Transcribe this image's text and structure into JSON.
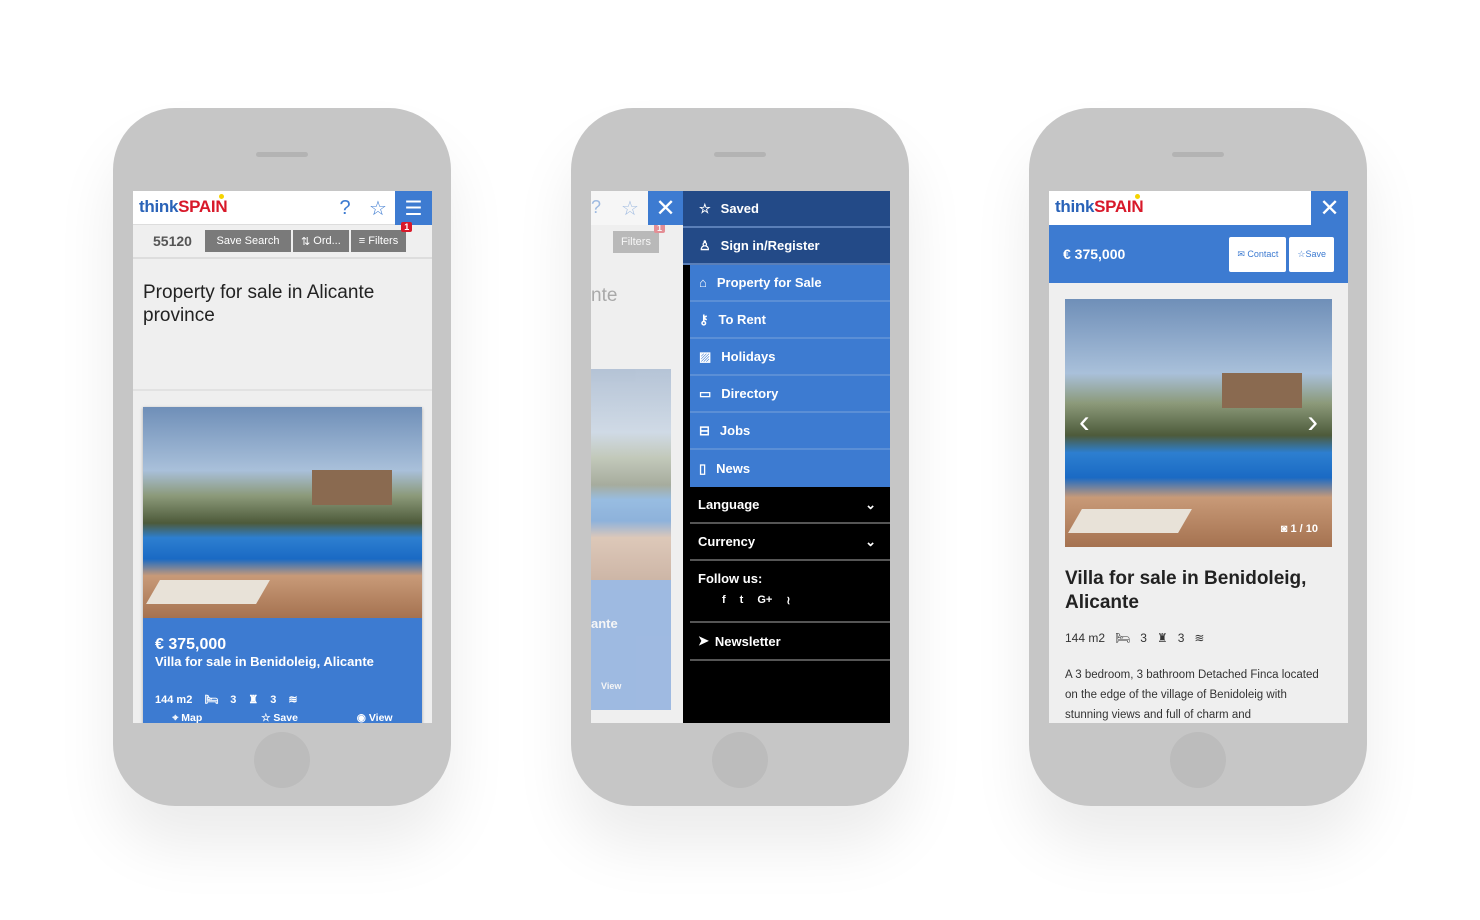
{
  "brand": {
    "think": "think",
    "spain": "SPAIN"
  },
  "colors": {
    "primary": "#3d7bd1",
    "menu_dark": "#234a87",
    "logo_blue": "#2a63b8",
    "logo_red": "#d8192a"
  },
  "list_screen": {
    "count": "55120",
    "save_search": "Save Search",
    "order": "Ord...",
    "filters": "Filters",
    "filters_badge": "1",
    "page_title": "Property for sale in Alicante province",
    "card": {
      "price": "€ 375,000",
      "title": "Villa for sale in Benidoleig, Alicante",
      "area": "144 m2",
      "beds": "3",
      "baths": "3",
      "map": "Map",
      "save": "Save",
      "view": "View"
    }
  },
  "menu_screen": {
    "partial_title": "nte",
    "partial_card": "ante",
    "filters": "Filters",
    "filters_badge": "1",
    "view": "View",
    "items": [
      {
        "label": "Saved",
        "icon": "star-icon"
      },
      {
        "label": "Sign in/Register",
        "icon": "user-icon"
      },
      {
        "label": "Property for Sale",
        "icon": "house-icon"
      },
      {
        "label": "To Rent",
        "icon": "key-icon"
      },
      {
        "label": "Holidays",
        "icon": "image-icon"
      },
      {
        "label": "Directory",
        "icon": "folder-icon"
      },
      {
        "label": "Jobs",
        "icon": "briefcase-icon"
      },
      {
        "label": "News",
        "icon": "document-icon"
      }
    ],
    "language": "Language",
    "currency": "Currency",
    "follow": "Follow us:",
    "social": [
      "f",
      "t",
      "G+",
      "rss"
    ],
    "newsletter": "Newsletter"
  },
  "detail_screen": {
    "price": "€ 375,000",
    "contact": "Contact",
    "save": "Save",
    "photo_counter": "1 / 10",
    "title": "Villa for sale in Benidoleig, Alicante",
    "area": "144 m2",
    "beds": "3",
    "baths": "3",
    "description": "A 3 bedroom, 3 bathroom Detached Finca located on the edge of the village of Benidoleig with stunning views and full of charm and"
  }
}
